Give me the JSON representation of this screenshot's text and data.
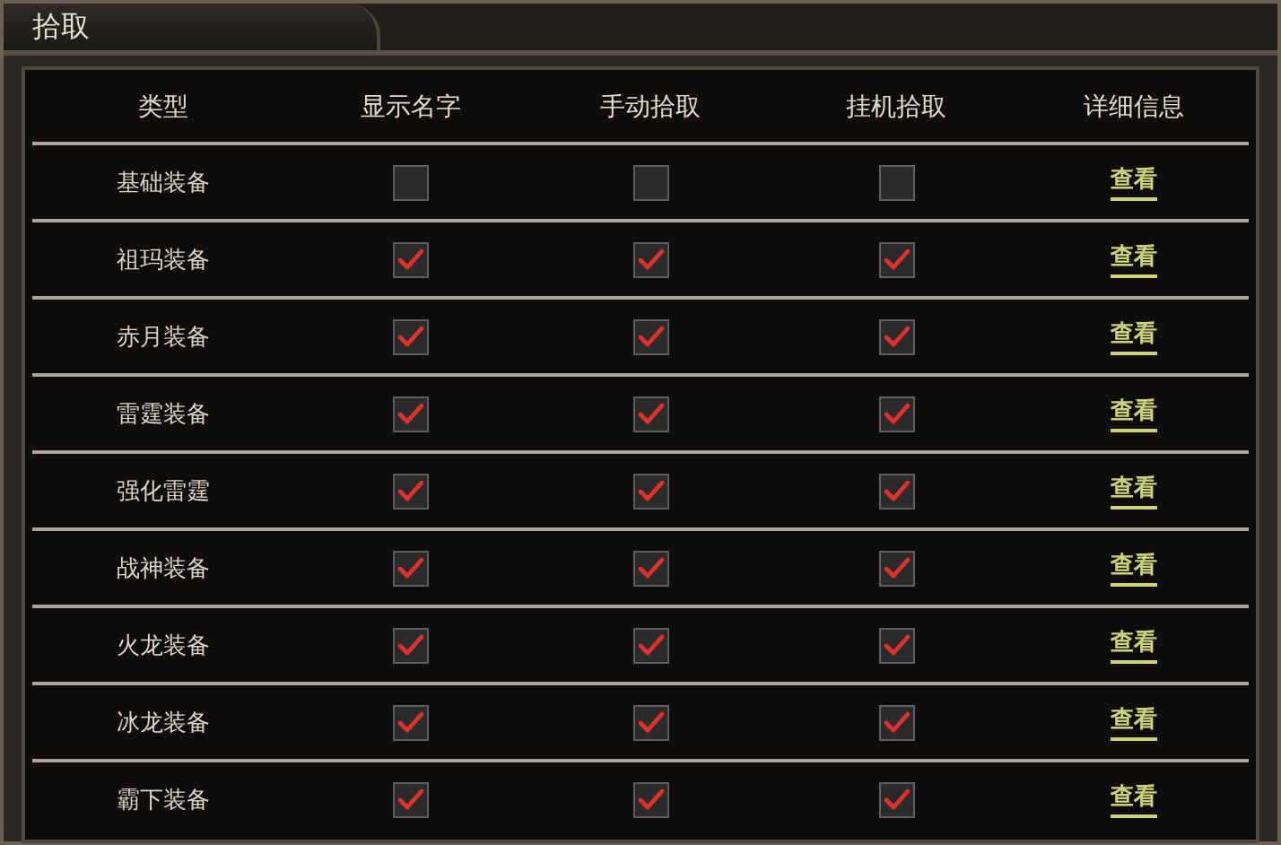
{
  "window": {
    "title": "拾取"
  },
  "table": {
    "columns": [
      "类型",
      "显示名字",
      "手动拾取",
      "挂机拾取",
      "详细信息"
    ],
    "rows": [
      {
        "type": "基础装备",
        "show_name": false,
        "manual_pickup": false,
        "auto_pickup": false,
        "details": "查看"
      },
      {
        "type": "祖玛装备",
        "show_name": true,
        "manual_pickup": true,
        "auto_pickup": true,
        "details": "查看"
      },
      {
        "type": "赤月装备",
        "show_name": true,
        "manual_pickup": true,
        "auto_pickup": true,
        "details": "查看"
      },
      {
        "type": "雷霆装备",
        "show_name": true,
        "manual_pickup": true,
        "auto_pickup": true,
        "details": "查看"
      },
      {
        "type": "强化雷霆",
        "show_name": true,
        "manual_pickup": true,
        "auto_pickup": true,
        "details": "查看"
      },
      {
        "type": "战神装备",
        "show_name": true,
        "manual_pickup": true,
        "auto_pickup": true,
        "details": "查看"
      },
      {
        "type": "火龙装备",
        "show_name": true,
        "manual_pickup": true,
        "auto_pickup": true,
        "details": "查看"
      },
      {
        "type": "冰龙装备",
        "show_name": true,
        "manual_pickup": true,
        "auto_pickup": true,
        "details": "查看"
      },
      {
        "type": "霸下装备",
        "show_name": true,
        "manual_pickup": true,
        "auto_pickup": true,
        "details": "查看"
      }
    ]
  }
}
